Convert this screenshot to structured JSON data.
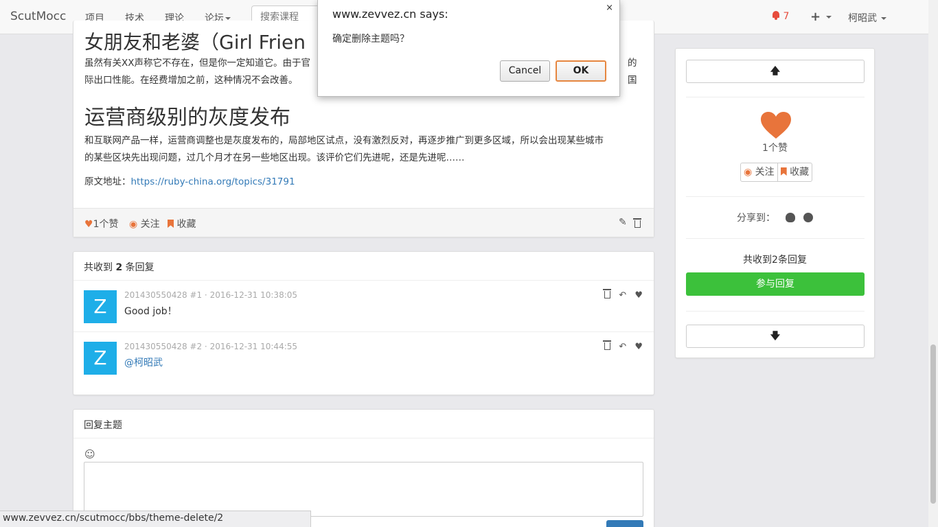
{
  "navbar": {
    "brand": "ScutMocc",
    "items": [
      "项目",
      "技术",
      "理论",
      "论坛"
    ],
    "search_placeholder": "搜索课程",
    "notification_count": "7",
    "plus": "+",
    "user": "柯昭武"
  },
  "article": {
    "heading_partial": "女朋友和老婆（Girl Frien",
    "para1": "虽然有关XX声称它不存在，但是你一定知道它。由于官",
    "para1_right": "的国",
    "para1_line2": "际出口性能。在经费增加之前，这种情况不会改善。",
    "heading2": "运营商级别的灰度发布",
    "para2_line1": "和互联网产品一样，运营商调整也是灰度发布的，局部地区试点，没有激烈反对，再逐步推广到更多区域，所以会出现某些城市",
    "para2_line2": "的某些区块先出现问题，过几个月才在另一些地区出现。该评价它们先进呢，还是先进呢……",
    "source_label": "原文地址：",
    "source_url": "https://ruby-china.org/topics/31791",
    "likes": "1个赞",
    "follow": "关注",
    "favorite": "收藏"
  },
  "replies": {
    "header_prefix": "共收到",
    "header_count": "2",
    "header_suffix": "条回复",
    "items": [
      {
        "avatar": "Z",
        "meta": "201430550428 #1 · 2016-12-31 10:38:05",
        "body": "Good job！"
      },
      {
        "avatar": "Z",
        "meta": "201430550428 #2 · 2016-12-31 10:44:55",
        "body": "@柯昭武"
      }
    ]
  },
  "compose": {
    "title": "回复主题",
    "emoji": "☺"
  },
  "sidebar": {
    "up_arrow": "🡅",
    "likes": "1个赞",
    "follow": "关注",
    "favorite": "收藏",
    "share_label": "分享到：",
    "reply_count": "共收到2条回复",
    "join_reply": "参与回复",
    "down_arrow": "🡇"
  },
  "dialog": {
    "title": "www.zevvez.cn says:",
    "message": "确定删除主题吗？",
    "cancel": "Cancel",
    "ok": "OK",
    "close": "×"
  },
  "status_url": "www.zevvez.cn/scutmocc/bbs/theme-delete/2",
  "colors": {
    "accent_orange": "#e8743b",
    "notify_red": "#e74c3c",
    "avatar_blue": "#1eaee8",
    "join_green": "#3cc13b",
    "link_blue": "#337ab7"
  }
}
